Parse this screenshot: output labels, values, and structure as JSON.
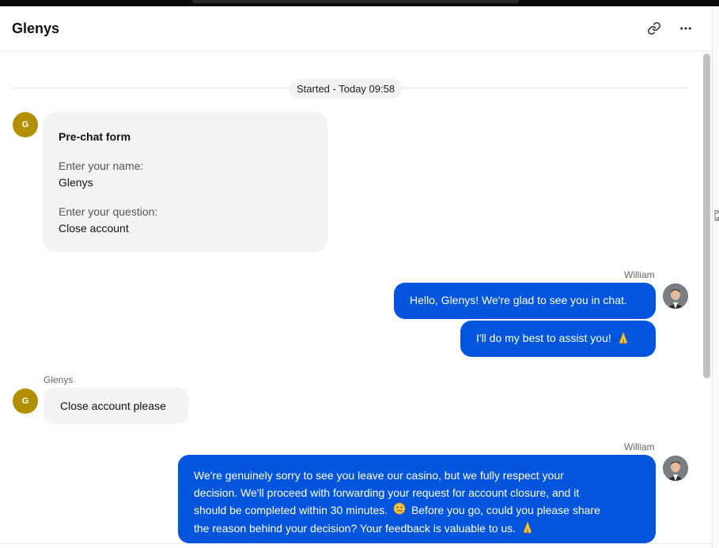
{
  "header": {
    "title": "Glenys"
  },
  "icons": {
    "link": "link-icon",
    "more": "more-horizontal-icon",
    "folded_hands": "folded-hands-emoji",
    "sad_face": "sad-face-emoji"
  },
  "colors": {
    "agent_bubble": "#0455dd",
    "visitor_avatar": "#b38f00",
    "user_bubble": "#f3f3f3"
  },
  "chat": {
    "started_label": "Started - Today 09:58",
    "prechat": {
      "avatar_initial": "G",
      "title": "Pre-chat form",
      "name_label": "Enter your name:",
      "name_value": "Glenys",
      "question_label": "Enter your question:",
      "question_value": "Close account"
    },
    "messages": [
      {
        "sender": "William",
        "lines": [
          "Hello, Glenys! We're glad to see you in chat.",
          "I'll do my best to assist you!"
        ]
      },
      {
        "sender": "Glenys",
        "avatar_initial": "G",
        "text": "Close account please"
      },
      {
        "sender": "William",
        "lines": [
          "We're genuinely sorry to see you leave our casino, but we fully respect your",
          "decision. We'll proceed with forwarding your request for account closure, and it",
          "should be completed within 30 minutes.",
          "Before you go, could you please share",
          "the reason behind your decision? Your feedback is valuable to us."
        ]
      }
    ]
  },
  "edge_fragment": [
    "pc",
    "la"
  ]
}
